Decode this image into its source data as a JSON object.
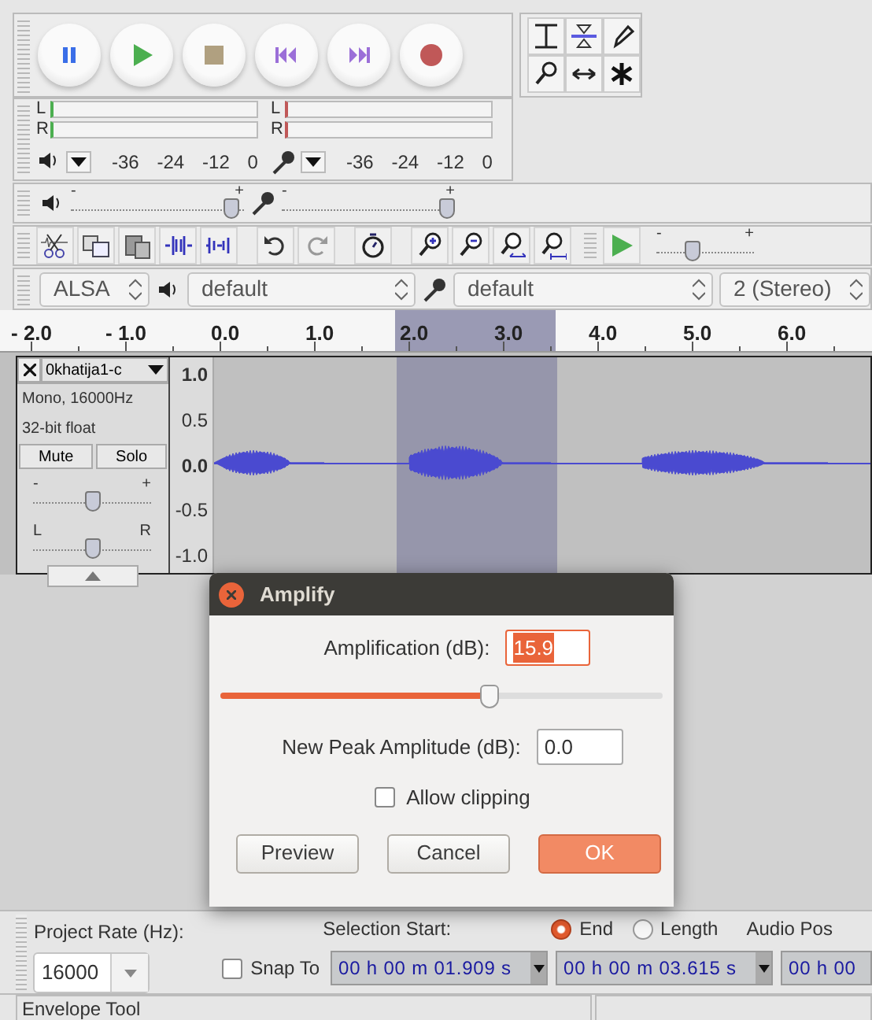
{
  "meters": [
    {
      "channels": [
        "L",
        "R"
      ],
      "scale": [
        "-36",
        "-24",
        "-12",
        "0"
      ]
    },
    {
      "channels": [
        "L",
        "R"
      ],
      "scale": [
        "-36",
        "-24",
        "-12",
        "0"
      ]
    }
  ],
  "mixer": {
    "playback": {
      "min": "-",
      "max": "+",
      "level": 0.97
    },
    "recording": {
      "min": "-",
      "max": "+",
      "level": 1.0
    }
  },
  "play_at_speed": {
    "min": "-",
    "max": "+",
    "level": 0.35
  },
  "devices": {
    "host": "ALSA",
    "playback": "default",
    "recording": "default",
    "channels": "2 (Stereo)"
  },
  "ruler": {
    "ticks": [
      "- 2.0",
      "- 1.0",
      "0.0",
      "1.0",
      "2.0",
      "3.0",
      "4.0",
      "5.0",
      "6.0"
    ]
  },
  "track": {
    "name": "0khatija1-c",
    "info": [
      "Mono, 16000Hz",
      "32-bit float"
    ],
    "mute": "Mute",
    "solo": "Solo",
    "gain": {
      "min": "-",
      "max": "+",
      "level": 0.5
    },
    "pan": {
      "min": "L",
      "max": "R",
      "level": 0.5
    },
    "scale": [
      "1.0",
      "0.5",
      "0.0",
      "-0.5",
      "-1.0"
    ]
  },
  "dialog": {
    "title": "Amplify",
    "amplification_label": "Amplification (dB):",
    "amplification": "15.9",
    "level": 0.61,
    "peak_label": "New Peak Amplitude (dB):",
    "peak": "0.0",
    "allow_clipping": {
      "label": "Allow clipping",
      "checked": false
    },
    "buttons": [
      {
        "label": "Preview",
        "kind": "default"
      },
      {
        "label": "Cancel",
        "kind": "default"
      },
      {
        "label": "OK",
        "kind": "primary"
      }
    ]
  },
  "selection_bar": {
    "project_rate_label": "Project Rate (Hz):",
    "project_rate": "16000",
    "selection_start_label": "Selection Start:",
    "modes": [
      {
        "label": "End",
        "selected": true
      },
      {
        "label": "Length",
        "selected": false
      }
    ],
    "audio_position_label": "Audio Pos",
    "snap_to": {
      "label": "Snap To",
      "checked": false
    },
    "start": "00 h 00 m 01.909 s",
    "end": "00 h 00 m 03.615 s",
    "position": "00 h 00"
  },
  "status_bar": {
    "text": "Envelope Tool"
  }
}
